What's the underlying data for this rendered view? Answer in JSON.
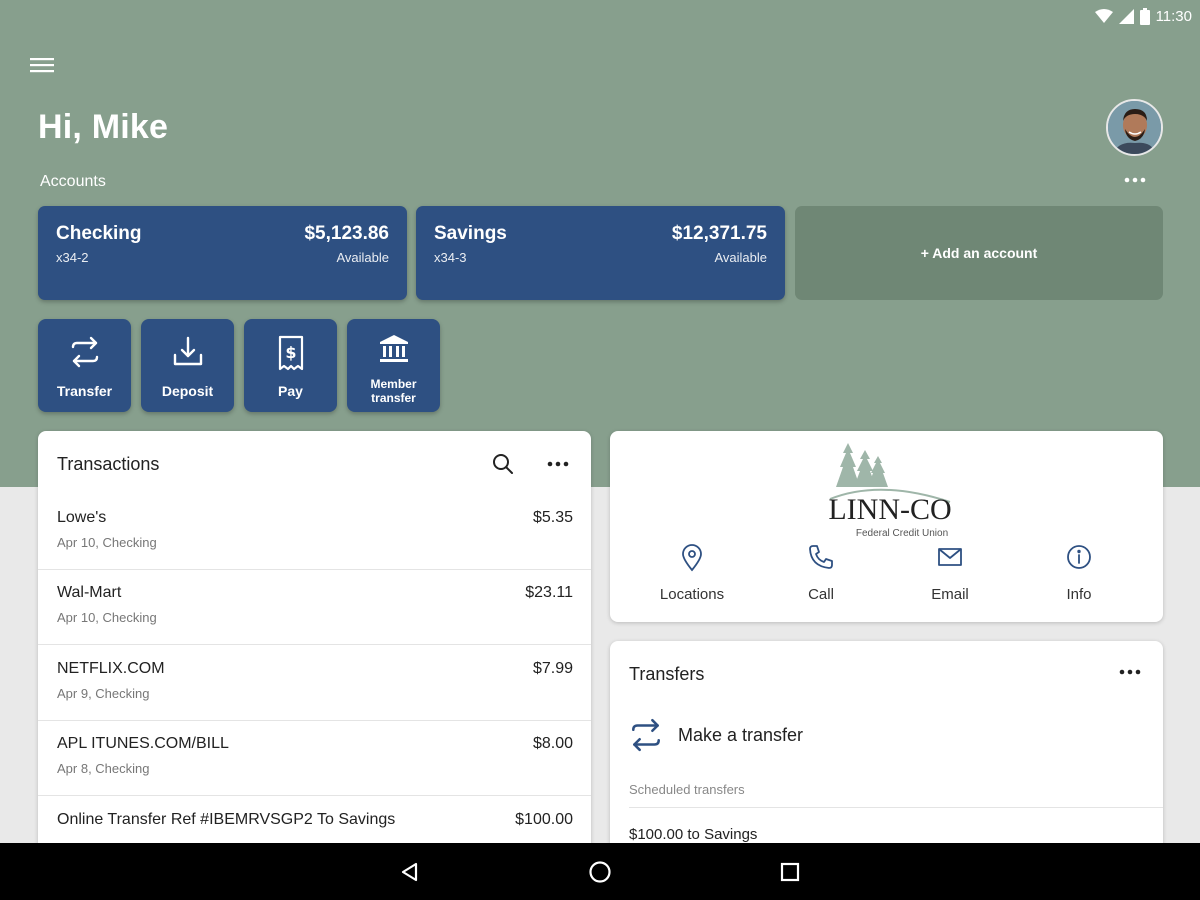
{
  "status_bar": {
    "time": "11:30"
  },
  "header": {
    "greeting": "Hi, Mike"
  },
  "accounts": {
    "label": "Accounts",
    "items": [
      {
        "name": "Checking",
        "number": "x34-2",
        "balance": "$5,123.86",
        "balance_label": "Available"
      },
      {
        "name": "Savings",
        "number": "x34-3",
        "balance": "$12,371.75",
        "balance_label": "Available"
      }
    ],
    "add_label": "+ Add an account"
  },
  "quick_actions": [
    {
      "label": "Transfer",
      "icon": "transfer-icon"
    },
    {
      "label": "Deposit",
      "icon": "deposit-icon"
    },
    {
      "label": "Pay",
      "icon": "pay-icon"
    },
    {
      "label": "Member transfer",
      "icon": "bank-icon"
    }
  ],
  "transactions": {
    "title": "Transactions",
    "items": [
      {
        "merchant": "Lowe's",
        "detail": "Apr 10, Checking",
        "amount": "$5.35"
      },
      {
        "merchant": "Wal-Mart",
        "detail": "Apr 10, Checking",
        "amount": "$23.11"
      },
      {
        "merchant": "NETFLIX.COM",
        "detail": "Apr 9, Checking",
        "amount": "$7.99"
      },
      {
        "merchant": "APL ITUNES.COM/BILL",
        "detail": "Apr 8, Checking",
        "amount": "$8.00"
      },
      {
        "merchant": "Online Transfer Ref #IBEMRVSGP2 To Savings",
        "detail": "",
        "amount": "$100.00"
      }
    ]
  },
  "credit_union": {
    "logo_name": "LINN-CO",
    "logo_subtitle": "Federal Credit Union",
    "actions": [
      {
        "label": "Locations",
        "icon": "location-pin-icon"
      },
      {
        "label": "Call",
        "icon": "phone-icon"
      },
      {
        "label": "Email",
        "icon": "mail-icon"
      },
      {
        "label": "Info",
        "icon": "info-icon"
      }
    ]
  },
  "transfers": {
    "title": "Transfers",
    "make_transfer_label": "Make a transfer",
    "scheduled_label": "Scheduled transfers",
    "scheduled_items": [
      "$100.00 to Savings"
    ]
  },
  "colors": {
    "hero_bg": "#879f8d",
    "accent_blue": "#2e5082",
    "add_card_bg": "#6f8775",
    "page_bg": "#e9e9e9"
  }
}
